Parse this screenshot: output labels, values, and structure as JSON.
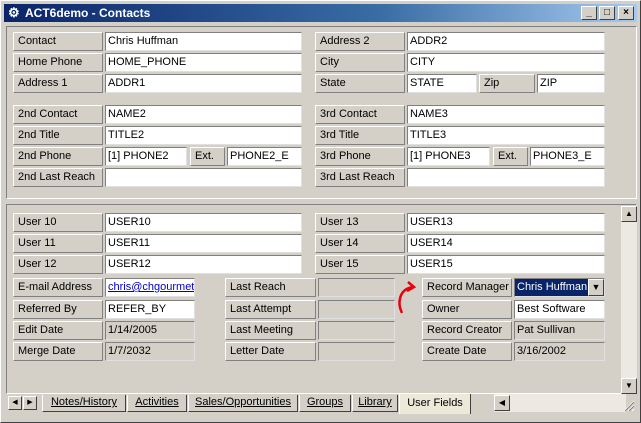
{
  "window": {
    "title": "ACT6demo - Contacts",
    "controls": {
      "minimize": "_",
      "maximize": "□",
      "close": "×"
    }
  },
  "contact": {
    "contact_label": "Contact",
    "contact_value": "Chris Huffman",
    "address2_label": "Address 2",
    "address2_value": "ADDR2",
    "home_phone_label": "Home Phone",
    "home_phone_value": "HOME_PHONE",
    "city_label": "City",
    "city_value": "CITY",
    "address1_label": "Address 1",
    "address1_value": "ADDR1",
    "state_label": "State",
    "state_value": "STATE",
    "zip_label": "Zip",
    "zip_value": "ZIP"
  },
  "secondary": {
    "c2_contact_label": "2nd Contact",
    "c2_contact_value": "NAME2",
    "c3_contact_label": "3rd Contact",
    "c3_contact_value": "NAME3",
    "c2_title_label": "2nd Title",
    "c2_title_value": "TITLE2",
    "c3_title_label": "3rd Title",
    "c3_title_value": "TITLE3",
    "c2_phone_label": "2nd Phone",
    "c2_phone_value": "[1] PHONE2",
    "c2_ext_label": "Ext.",
    "c2_ext_value": "PHONE2_E",
    "c3_phone_label": "3rd Phone",
    "c3_phone_value": "[1] PHONE3",
    "c3_ext_label": "Ext.",
    "c3_ext_value": "PHONE3_E",
    "c2_last_reach_label": "2nd Last Reach",
    "c2_last_reach_value": "",
    "c3_last_reach_label": "3rd Last Reach",
    "c3_last_reach_value": ""
  },
  "user_fields": {
    "user10_label": "User 10",
    "user10_value": "USER10",
    "user13_label": "User 13",
    "user13_value": "USER13",
    "user11_label": "User 11",
    "user11_value": "USER11",
    "user14_label": "User 14",
    "user14_value": "USER14",
    "user12_label": "User 12",
    "user12_value": "USER12",
    "user15_label": "User 15",
    "user15_value": "USER15"
  },
  "details": {
    "email_label": "E-mail Address",
    "email_value": "chris@chgourmet",
    "last_reach_label": "Last Reach",
    "last_reach_value": "",
    "record_manager_label": "Record Manager",
    "record_manager_value": "Chris Huffman",
    "referred_by_label": "Referred By",
    "referred_by_value": "REFER_BY",
    "last_attempt_label": "Last Attempt",
    "last_attempt_value": "",
    "owner_label": "Owner",
    "owner_value": "Best Software",
    "edit_date_label": "Edit Date",
    "edit_date_value": "1/14/2005",
    "last_meeting_label": "Last Meeting",
    "last_meeting_value": "",
    "record_creator_label": "Record Creator",
    "record_creator_value": "Pat Sullivan",
    "merge_date_label": "Merge Date",
    "merge_date_value": "1/7/2032",
    "letter_date_label": "Letter Date",
    "letter_date_value": "",
    "create_date_label": "Create Date",
    "create_date_value": "3/16/2002"
  },
  "tabs": [
    {
      "label": "Notes/History"
    },
    {
      "label": "Activities"
    },
    {
      "label": "Sales/Opportunities"
    },
    {
      "label": "Groups"
    },
    {
      "label": "Library"
    },
    {
      "label": "User Fields"
    }
  ],
  "colors": {
    "titlebar_start": "#0a246a",
    "titlebar_end": "#a6caf0",
    "face": "#d4d0c8",
    "annotation_arrow": "#e8000b",
    "link": "#0000cc"
  },
  "icons": {
    "app": "act-app-icon",
    "dropdown": "chevron-down-icon",
    "scroll_up": "arrow-up-icon",
    "scroll_down": "arrow-down-icon",
    "tab_prev": "arrow-left-icon",
    "tab_next": "arrow-right-icon",
    "annotation": "curved-arrow-icon"
  }
}
